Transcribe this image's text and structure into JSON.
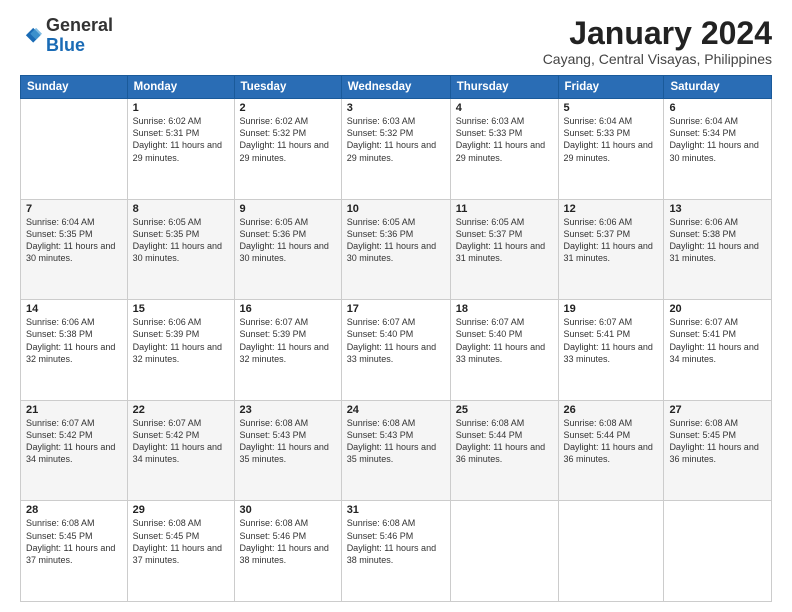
{
  "logo": {
    "general": "General",
    "blue": "Blue"
  },
  "title": "January 2024",
  "subtitle": "Cayang, Central Visayas, Philippines",
  "days_header": [
    "Sunday",
    "Monday",
    "Tuesday",
    "Wednesday",
    "Thursday",
    "Friday",
    "Saturday"
  ],
  "weeks": [
    [
      null,
      {
        "num": "1",
        "sunrise": "6:02 AM",
        "sunset": "5:31 PM",
        "daylight": "11 hours and 29 minutes."
      },
      {
        "num": "2",
        "sunrise": "6:02 AM",
        "sunset": "5:32 PM",
        "daylight": "11 hours and 29 minutes."
      },
      {
        "num": "3",
        "sunrise": "6:03 AM",
        "sunset": "5:32 PM",
        "daylight": "11 hours and 29 minutes."
      },
      {
        "num": "4",
        "sunrise": "6:03 AM",
        "sunset": "5:33 PM",
        "daylight": "11 hours and 29 minutes."
      },
      {
        "num": "5",
        "sunrise": "6:04 AM",
        "sunset": "5:33 PM",
        "daylight": "11 hours and 29 minutes."
      },
      {
        "num": "6",
        "sunrise": "6:04 AM",
        "sunset": "5:34 PM",
        "daylight": "11 hours and 30 minutes."
      }
    ],
    [
      {
        "num": "7",
        "sunrise": "6:04 AM",
        "sunset": "5:35 PM",
        "daylight": "11 hours and 30 minutes."
      },
      {
        "num": "8",
        "sunrise": "6:05 AM",
        "sunset": "5:35 PM",
        "daylight": "11 hours and 30 minutes."
      },
      {
        "num": "9",
        "sunrise": "6:05 AM",
        "sunset": "5:36 PM",
        "daylight": "11 hours and 30 minutes."
      },
      {
        "num": "10",
        "sunrise": "6:05 AM",
        "sunset": "5:36 PM",
        "daylight": "11 hours and 30 minutes."
      },
      {
        "num": "11",
        "sunrise": "6:05 AM",
        "sunset": "5:37 PM",
        "daylight": "11 hours and 31 minutes."
      },
      {
        "num": "12",
        "sunrise": "6:06 AM",
        "sunset": "5:37 PM",
        "daylight": "11 hours and 31 minutes."
      },
      {
        "num": "13",
        "sunrise": "6:06 AM",
        "sunset": "5:38 PM",
        "daylight": "11 hours and 31 minutes."
      }
    ],
    [
      {
        "num": "14",
        "sunrise": "6:06 AM",
        "sunset": "5:38 PM",
        "daylight": "11 hours and 32 minutes."
      },
      {
        "num": "15",
        "sunrise": "6:06 AM",
        "sunset": "5:39 PM",
        "daylight": "11 hours and 32 minutes."
      },
      {
        "num": "16",
        "sunrise": "6:07 AM",
        "sunset": "5:39 PM",
        "daylight": "11 hours and 32 minutes."
      },
      {
        "num": "17",
        "sunrise": "6:07 AM",
        "sunset": "5:40 PM",
        "daylight": "11 hours and 33 minutes."
      },
      {
        "num": "18",
        "sunrise": "6:07 AM",
        "sunset": "5:40 PM",
        "daylight": "11 hours and 33 minutes."
      },
      {
        "num": "19",
        "sunrise": "6:07 AM",
        "sunset": "5:41 PM",
        "daylight": "11 hours and 33 minutes."
      },
      {
        "num": "20",
        "sunrise": "6:07 AM",
        "sunset": "5:41 PM",
        "daylight": "11 hours and 34 minutes."
      }
    ],
    [
      {
        "num": "21",
        "sunrise": "6:07 AM",
        "sunset": "5:42 PM",
        "daylight": "11 hours and 34 minutes."
      },
      {
        "num": "22",
        "sunrise": "6:07 AM",
        "sunset": "5:42 PM",
        "daylight": "11 hours and 34 minutes."
      },
      {
        "num": "23",
        "sunrise": "6:08 AM",
        "sunset": "5:43 PM",
        "daylight": "11 hours and 35 minutes."
      },
      {
        "num": "24",
        "sunrise": "6:08 AM",
        "sunset": "5:43 PM",
        "daylight": "11 hours and 35 minutes."
      },
      {
        "num": "25",
        "sunrise": "6:08 AM",
        "sunset": "5:44 PM",
        "daylight": "11 hours and 36 minutes."
      },
      {
        "num": "26",
        "sunrise": "6:08 AM",
        "sunset": "5:44 PM",
        "daylight": "11 hours and 36 minutes."
      },
      {
        "num": "27",
        "sunrise": "6:08 AM",
        "sunset": "5:45 PM",
        "daylight": "11 hours and 36 minutes."
      }
    ],
    [
      {
        "num": "28",
        "sunrise": "6:08 AM",
        "sunset": "5:45 PM",
        "daylight": "11 hours and 37 minutes."
      },
      {
        "num": "29",
        "sunrise": "6:08 AM",
        "sunset": "5:45 PM",
        "daylight": "11 hours and 37 minutes."
      },
      {
        "num": "30",
        "sunrise": "6:08 AM",
        "sunset": "5:46 PM",
        "daylight": "11 hours and 38 minutes."
      },
      {
        "num": "31",
        "sunrise": "6:08 AM",
        "sunset": "5:46 PM",
        "daylight": "11 hours and 38 minutes."
      },
      null,
      null,
      null
    ]
  ]
}
